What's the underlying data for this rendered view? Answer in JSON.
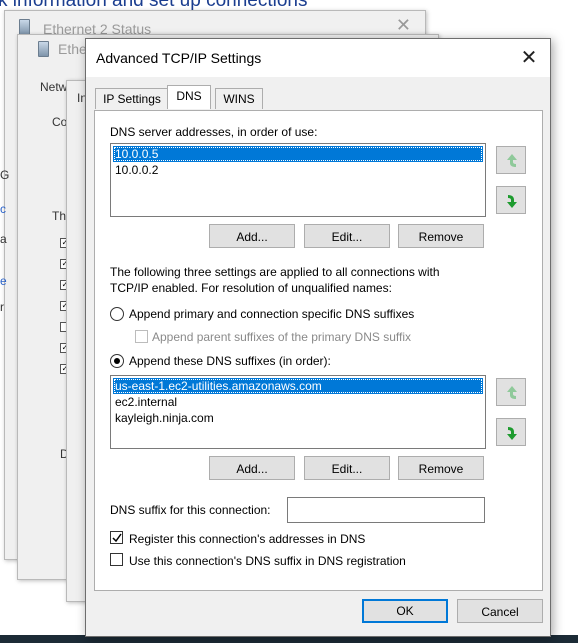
{
  "background": {
    "heading": "k information and set up connections",
    "window1_title": "Ethernet 2 Status",
    "window2_title": "Ethe",
    "window2_tab": "Netw",
    "window3_frag": "In",
    "frag_co": "Co",
    "frag_th": "Th",
    "frag_d": "D",
    "frag_g": "G",
    "frag_c": "c",
    "frag_a": "a",
    "frag_e": "e",
    "frag_r": "r"
  },
  "dialog": {
    "title": "Advanced TCP/IP Settings",
    "close_symbol": "✕",
    "tabs": [
      "IP Settings",
      "DNS",
      "WINS"
    ],
    "active_tab": "DNS"
  },
  "dns": {
    "servers_label": "DNS server addresses, in order of use:",
    "servers": [
      "10.0.0.5",
      "10.0.0.2"
    ],
    "selected_server": "10.0.0.5",
    "buttons": {
      "add": "Add...",
      "edit": "Edit...",
      "remove": "Remove"
    },
    "info_text": "The following three settings are applied to all connections with TCP/IP enabled. For resolution of unqualified names:",
    "option_primary": "Append primary and connection specific DNS suffixes",
    "option_parent": "Append parent suffixes of the primary DNS suffix",
    "option_these": "Append these DNS suffixes (in order):",
    "selected_option": "these",
    "suffixes": [
      "us-east-1.ec2-utilities.amazonaws.com",
      "ec2.internal",
      "kayleigh.ninja.com"
    ],
    "selected_suffix": "us-east-1.ec2-utilities.amazonaws.com",
    "suffix_buttons": {
      "add": "Add...",
      "edit": "Edit...",
      "remove": "Remove"
    },
    "connection_suffix_label": "DNS suffix for this connection:",
    "connection_suffix_value": "",
    "register_label": "Register this connection's addresses in DNS",
    "register_checked": true,
    "use_suffix_label": "Use this connection's DNS suffix in DNS registration",
    "use_suffix_checked": false
  },
  "footer": {
    "ok": "OK",
    "cancel": "Cancel"
  },
  "colors": {
    "selection": "#0078d7",
    "arrow_up_disabled": "#8fc99a",
    "arrow_down": "#1e9b2f",
    "heading": "#1a3d8f"
  },
  "icons": [
    "network-adapter-icon",
    "close-icon",
    "move-up-icon",
    "move-down-icon",
    "checkmark-icon"
  ]
}
